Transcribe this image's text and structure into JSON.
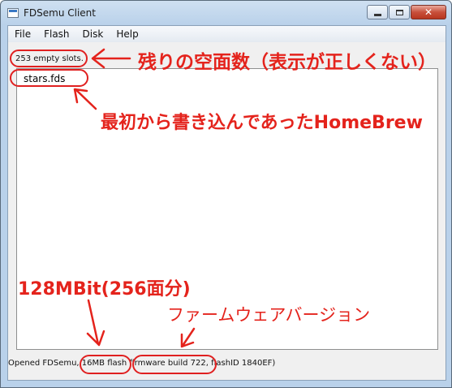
{
  "window": {
    "title": "FDSemu Client"
  },
  "caption": {
    "minimize": "minimize",
    "maximize": "maximize",
    "close": "✕"
  },
  "menu": {
    "items": [
      "File",
      "Flash",
      "Disk",
      "Help"
    ]
  },
  "slots": {
    "label": "253 empty slots."
  },
  "list": {
    "items": [
      "stars.fds"
    ]
  },
  "status": {
    "prefix": "Opened FDSemu,",
    "flash": "16MB flash",
    "firmware": "firmware build 722,",
    "suffix": "flashID 1840EF)"
  },
  "annotations": {
    "slots_note": "残りの空面数（表示が正しくない）",
    "homebrew_note": "最初から書き込んであったHomeBrew",
    "capacity_note": "128MBit(256面分)",
    "firmware_note": "ファームウェアバージョン"
  },
  "colors": {
    "annotation": "#e4231c",
    "titlebar": "#b9d1ea"
  }
}
